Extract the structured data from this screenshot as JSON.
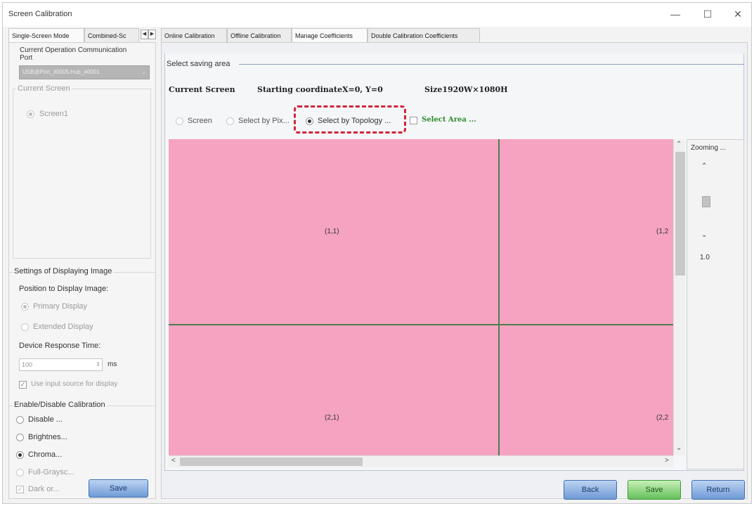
{
  "window": {
    "title": "Screen Calibration",
    "minimize": "—",
    "maximize": "☐",
    "close": "✕"
  },
  "left_tabs": [
    {
      "label": "Single-Screen Mode"
    },
    {
      "label": "Combined-Sc"
    }
  ],
  "left_tab_arrows": {
    "prev": "◀",
    "next": "▶"
  },
  "comm": {
    "label": "Current Operation Communication Port",
    "value": "USB@Port_#0005.Hub_#0001"
  },
  "current_screen": {
    "title": "Current Screen",
    "screen": "Screen1"
  },
  "display_settings": {
    "title": "Settings of Displaying Image",
    "position_label": "Position to Display Image:",
    "primary": "Primary Display",
    "extended": "Extended Display",
    "response_label": "Device Response Time:",
    "response_value": "100",
    "response_unit": "ms",
    "use_input_source": "Use input source for display"
  },
  "calibration": {
    "title": "Enable/Disable Calibration",
    "disable": "Disable ...",
    "brightness": "Brightnes...",
    "chroma": "Chroma...",
    "full_grayscale": "Full-Graysc...",
    "dark_or": "Dark or...",
    "save": "Save"
  },
  "right_tabs": [
    {
      "label": "Online Calibration"
    },
    {
      "label": "Offline Calibration"
    },
    {
      "label": "Manage Coefficients"
    },
    {
      "label": "Double Calibration Coefficients"
    }
  ],
  "saving_area": {
    "title": "Select saving area",
    "current_screen": "Current Screen",
    "starting": "Starting coordinateX=0, Y=0",
    "size": "Size1920W×1080H",
    "opt_screen": "Screen",
    "opt_pixel": "Select by Pix...",
    "opt_topology": "Select by Topology ...",
    "select_area": "Select Area ..."
  },
  "grid_cells": [
    "(1,1)",
    "(1,2",
    "(2,1)",
    "(2,2"
  ],
  "scroll": {
    "up": "⌃",
    "down": "⌄",
    "left": "<",
    "right": ">"
  },
  "zoom": {
    "title": "Zooming ...",
    "up": "⌃",
    "down": "⌄",
    "value": "1.0"
  },
  "buttons": {
    "back": "Back",
    "save": "Save",
    "return": "Return"
  }
}
